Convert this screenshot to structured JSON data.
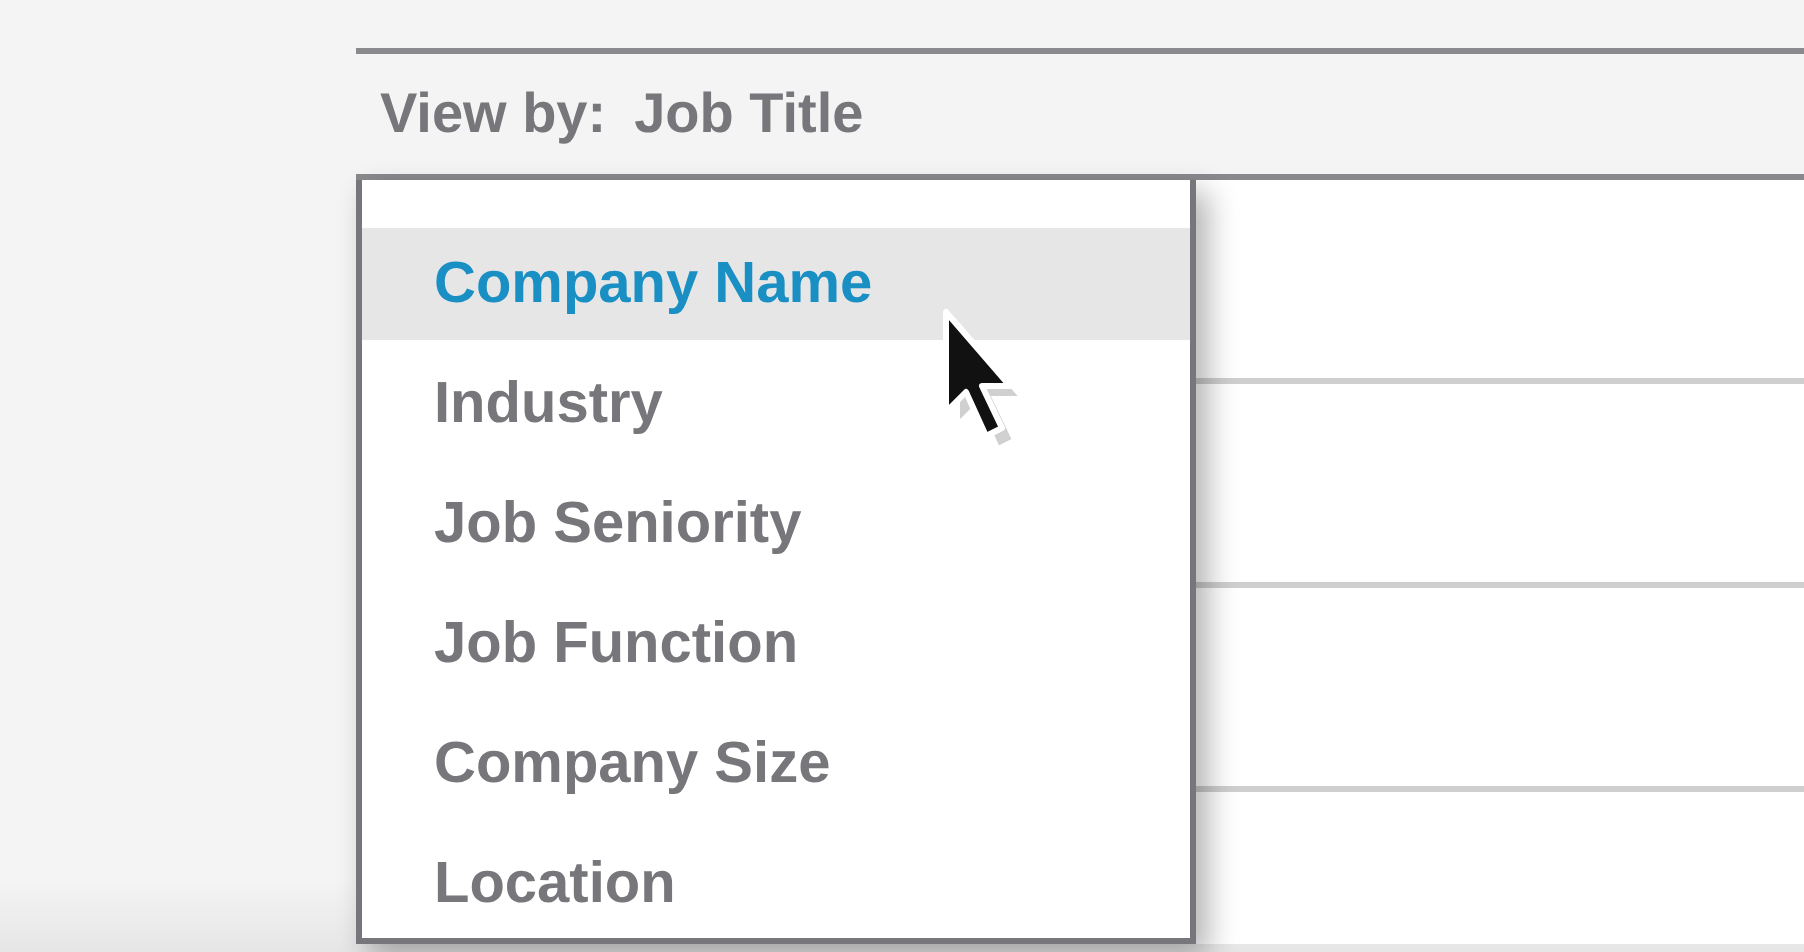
{
  "view_by": {
    "label": "View by:",
    "value": "Job Title"
  },
  "dropdown": {
    "items": [
      {
        "label": "Company Name",
        "selected": true
      },
      {
        "label": "Industry",
        "selected": false
      },
      {
        "label": "Job Seniority",
        "selected": false
      },
      {
        "label": "Job Function",
        "selected": false
      },
      {
        "label": "Company Size",
        "selected": false
      },
      {
        "label": "Location",
        "selected": false
      }
    ]
  }
}
